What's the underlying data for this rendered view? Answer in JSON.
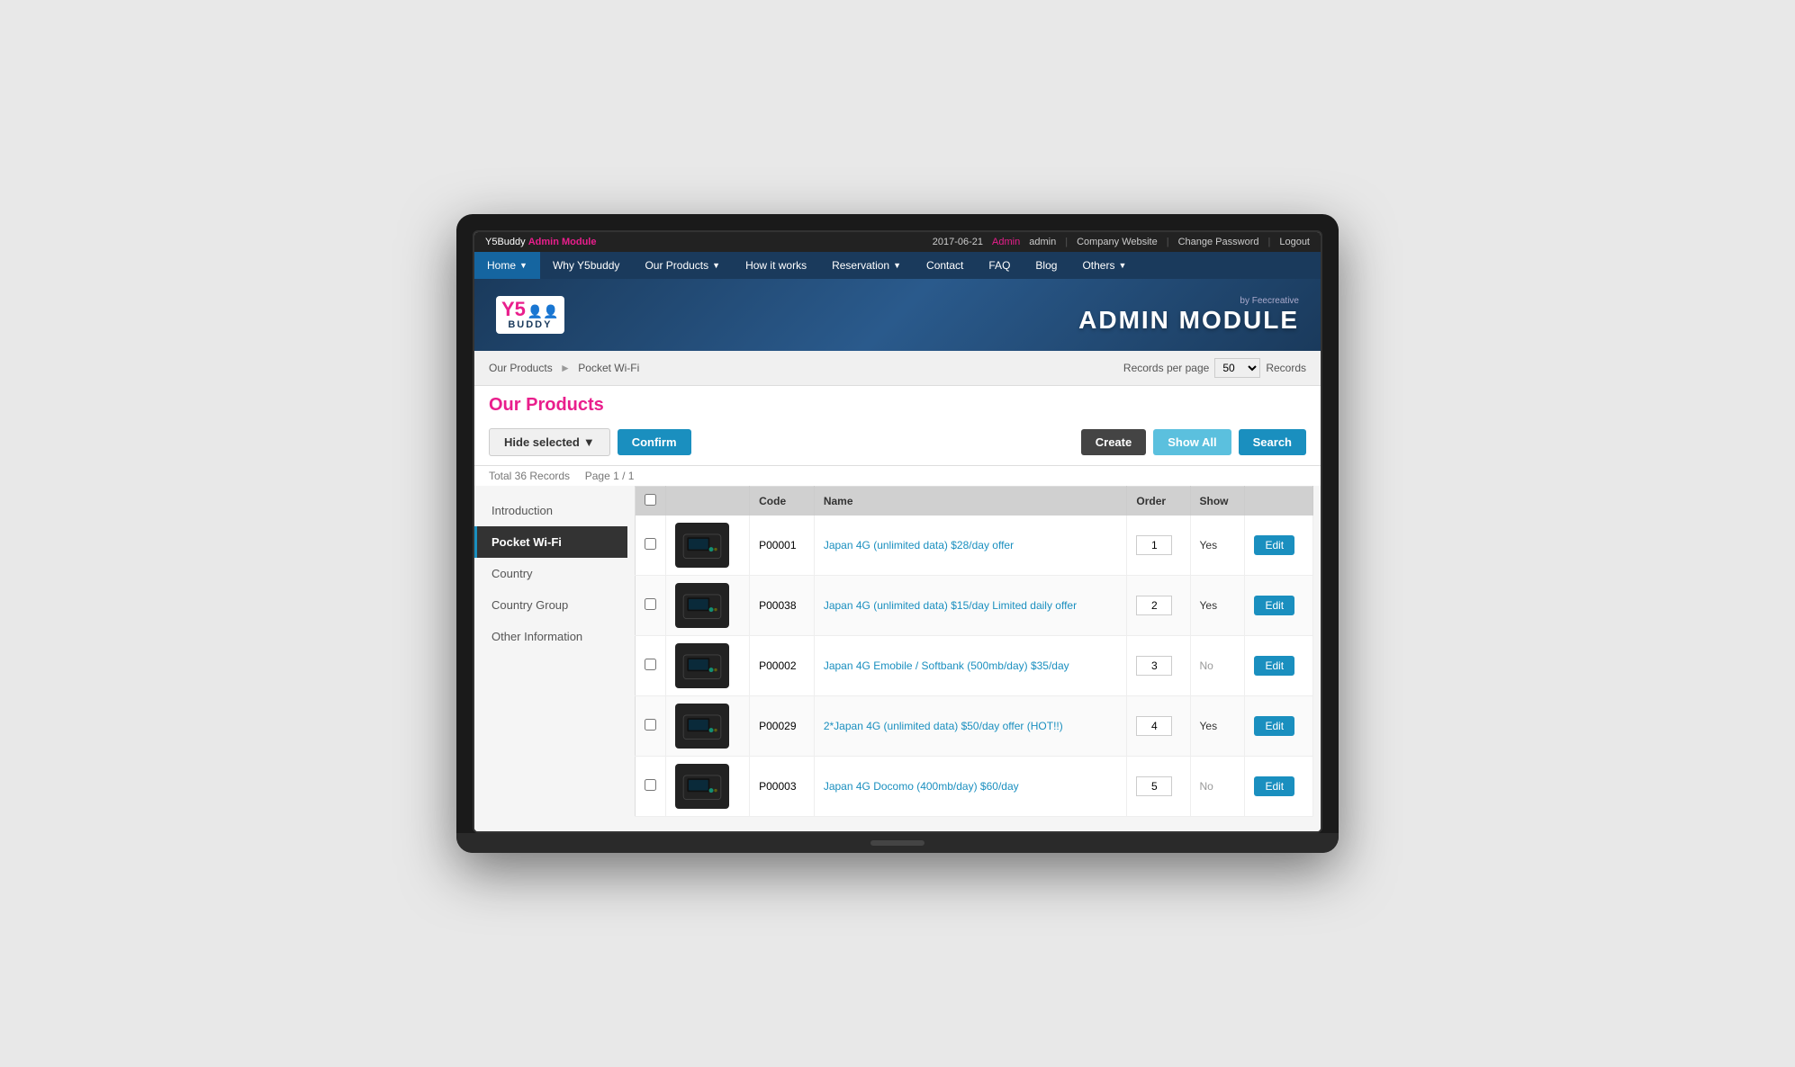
{
  "browser": {
    "top_bar": {
      "brand": "Y5Buddy",
      "brand_highlight": "Admin Module",
      "date": "2017-06-21",
      "admin_label": "Admin",
      "username": "admin",
      "links": [
        "Company Website",
        "Change Password",
        "Logout"
      ]
    }
  },
  "nav": {
    "items": [
      {
        "label": "Home",
        "has_arrow": true,
        "active": false
      },
      {
        "label": "Why Y5buddy",
        "has_arrow": false,
        "active": false
      },
      {
        "label": "Our Products",
        "has_arrow": true,
        "active": true
      },
      {
        "label": "How it works",
        "has_arrow": false,
        "active": false
      },
      {
        "label": "Reservation",
        "has_arrow": true,
        "active": false
      },
      {
        "label": "Contact",
        "has_arrow": false,
        "active": false
      },
      {
        "label": "FAQ",
        "has_arrow": false,
        "active": false
      },
      {
        "label": "Blog",
        "has_arrow": false,
        "active": false
      },
      {
        "label": "Others",
        "has_arrow": true,
        "active": false
      }
    ]
  },
  "header": {
    "logo_y5": "Y5",
    "logo_buddy": "BUDDY",
    "by_text": "by Feecreative",
    "admin_title": "ADMIN MODULE"
  },
  "breadcrumb": {
    "items": [
      "Our Products",
      "Pocket Wi-Fi"
    ]
  },
  "records": {
    "per_page_label": "Records per page",
    "per_page_value": "50",
    "records_label": "Records"
  },
  "toolbar": {
    "hide_selected_label": "Hide selected",
    "confirm_label": "Confirm",
    "create_label": "Create",
    "show_all_label": "Show All",
    "search_label": "Search",
    "total_text": "Total 36 Records",
    "page_text": "Page 1 / 1"
  },
  "sidebar": {
    "items": [
      {
        "label": "Introduction",
        "active": false
      },
      {
        "label": "Pocket Wi-Fi",
        "active": true
      },
      {
        "label": "Country",
        "active": false
      },
      {
        "label": "Country Group",
        "active": false
      },
      {
        "label": "Other Information",
        "active": false
      }
    ]
  },
  "table": {
    "headers": [
      "",
      "",
      "Code",
      "Name",
      "Order",
      "Show",
      ""
    ],
    "rows": [
      {
        "code": "P00001",
        "name": "Japan 4G (unlimited data) $28/day offer",
        "order": "1",
        "show": "Yes",
        "show_class": "show-yes"
      },
      {
        "code": "P00038",
        "name": "Japan 4G (unlimited data) $15/day Limited daily offer",
        "order": "2",
        "show": "Yes",
        "show_class": "show-yes"
      },
      {
        "code": "P00002",
        "name": "Japan 4G Emobile / Softbank (500mb/day) $35/day",
        "order": "3",
        "show": "No",
        "show_class": "show-no"
      },
      {
        "code": "P00029",
        "name": "2*Japan 4G (unlimited data) $50/day offer (HOT!!)",
        "order": "4",
        "show": "Yes",
        "show_class": "show-yes"
      },
      {
        "code": "P00003",
        "name": "Japan 4G Docomo (400mb/day) $60/day",
        "order": "5",
        "show": "No",
        "show_class": "show-no"
      }
    ]
  }
}
